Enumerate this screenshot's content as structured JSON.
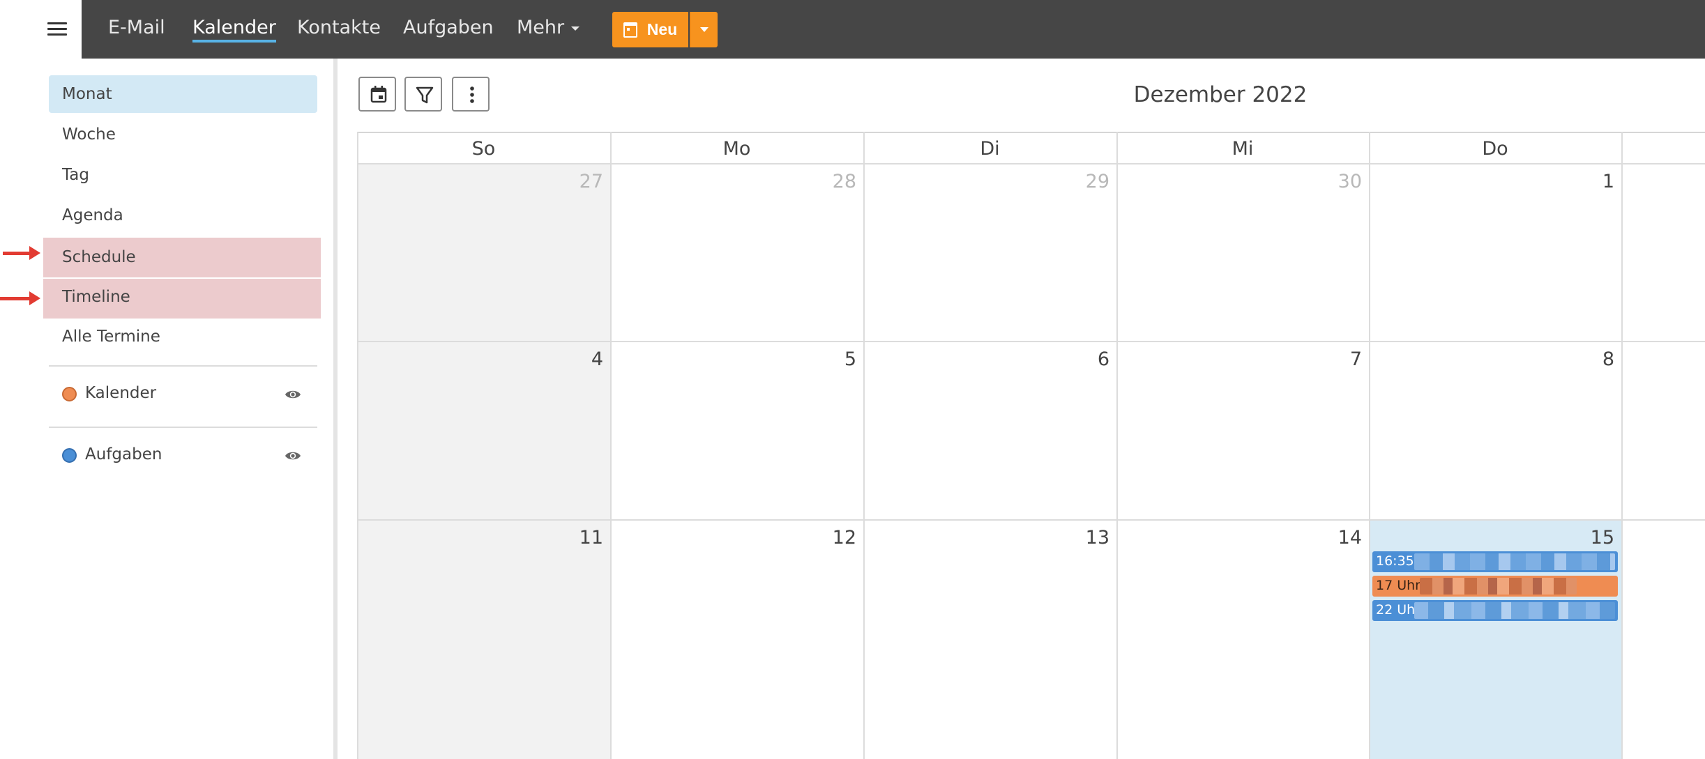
{
  "nav": {
    "items": [
      "E-Mail",
      "Kalender",
      "Kontakte",
      "Aufgaben",
      "Mehr"
    ],
    "active": "Kalender",
    "new_label": "Neu",
    "accent": "#f7931e"
  },
  "sidebar": {
    "views": [
      "Monat",
      "Woche",
      "Tag",
      "Agenda",
      "Schedule",
      "Timeline",
      "Alle Termine"
    ],
    "selected": "Monat",
    "highlighted": [
      "Schedule",
      "Timeline"
    ],
    "calendars": [
      {
        "name": "Kalender",
        "color": "#ef8c52",
        "icon": "eye-icon"
      },
      {
        "name": "Aufgaben",
        "color": "#4b8fd6",
        "icon": "eye-icon"
      }
    ]
  },
  "toolbar": {
    "icons": [
      "calendar-icon",
      "filter-icon",
      "more-vertical-icon"
    ]
  },
  "calendar": {
    "title": "Dezember 2022",
    "weekdays": [
      "So",
      "Mo",
      "Di",
      "Mi",
      "Do"
    ],
    "weeks": [
      [
        {
          "day": "27",
          "other": true
        },
        {
          "day": "28",
          "other": true
        },
        {
          "day": "29",
          "other": true
        },
        {
          "day": "30",
          "other": true
        },
        {
          "day": "1",
          "other": false
        }
      ],
      [
        {
          "day": "4",
          "other": false
        },
        {
          "day": "5",
          "other": false
        },
        {
          "day": "6",
          "other": false
        },
        {
          "day": "7",
          "other": false
        },
        {
          "day": "8",
          "other": false
        }
      ],
      [
        {
          "day": "11",
          "other": false
        },
        {
          "day": "12",
          "other": false
        },
        {
          "day": "13",
          "other": false
        },
        {
          "day": "14",
          "other": false
        },
        {
          "day": "15",
          "other": false,
          "today": true
        }
      ]
    ],
    "events": [
      {
        "time": "16:35",
        "color": "#4b8fd6"
      },
      {
        "time": "17 Uhr",
        "color": "#ef8c52"
      },
      {
        "time": "22 Uhr",
        "color": "#4b8fd6"
      }
    ]
  }
}
